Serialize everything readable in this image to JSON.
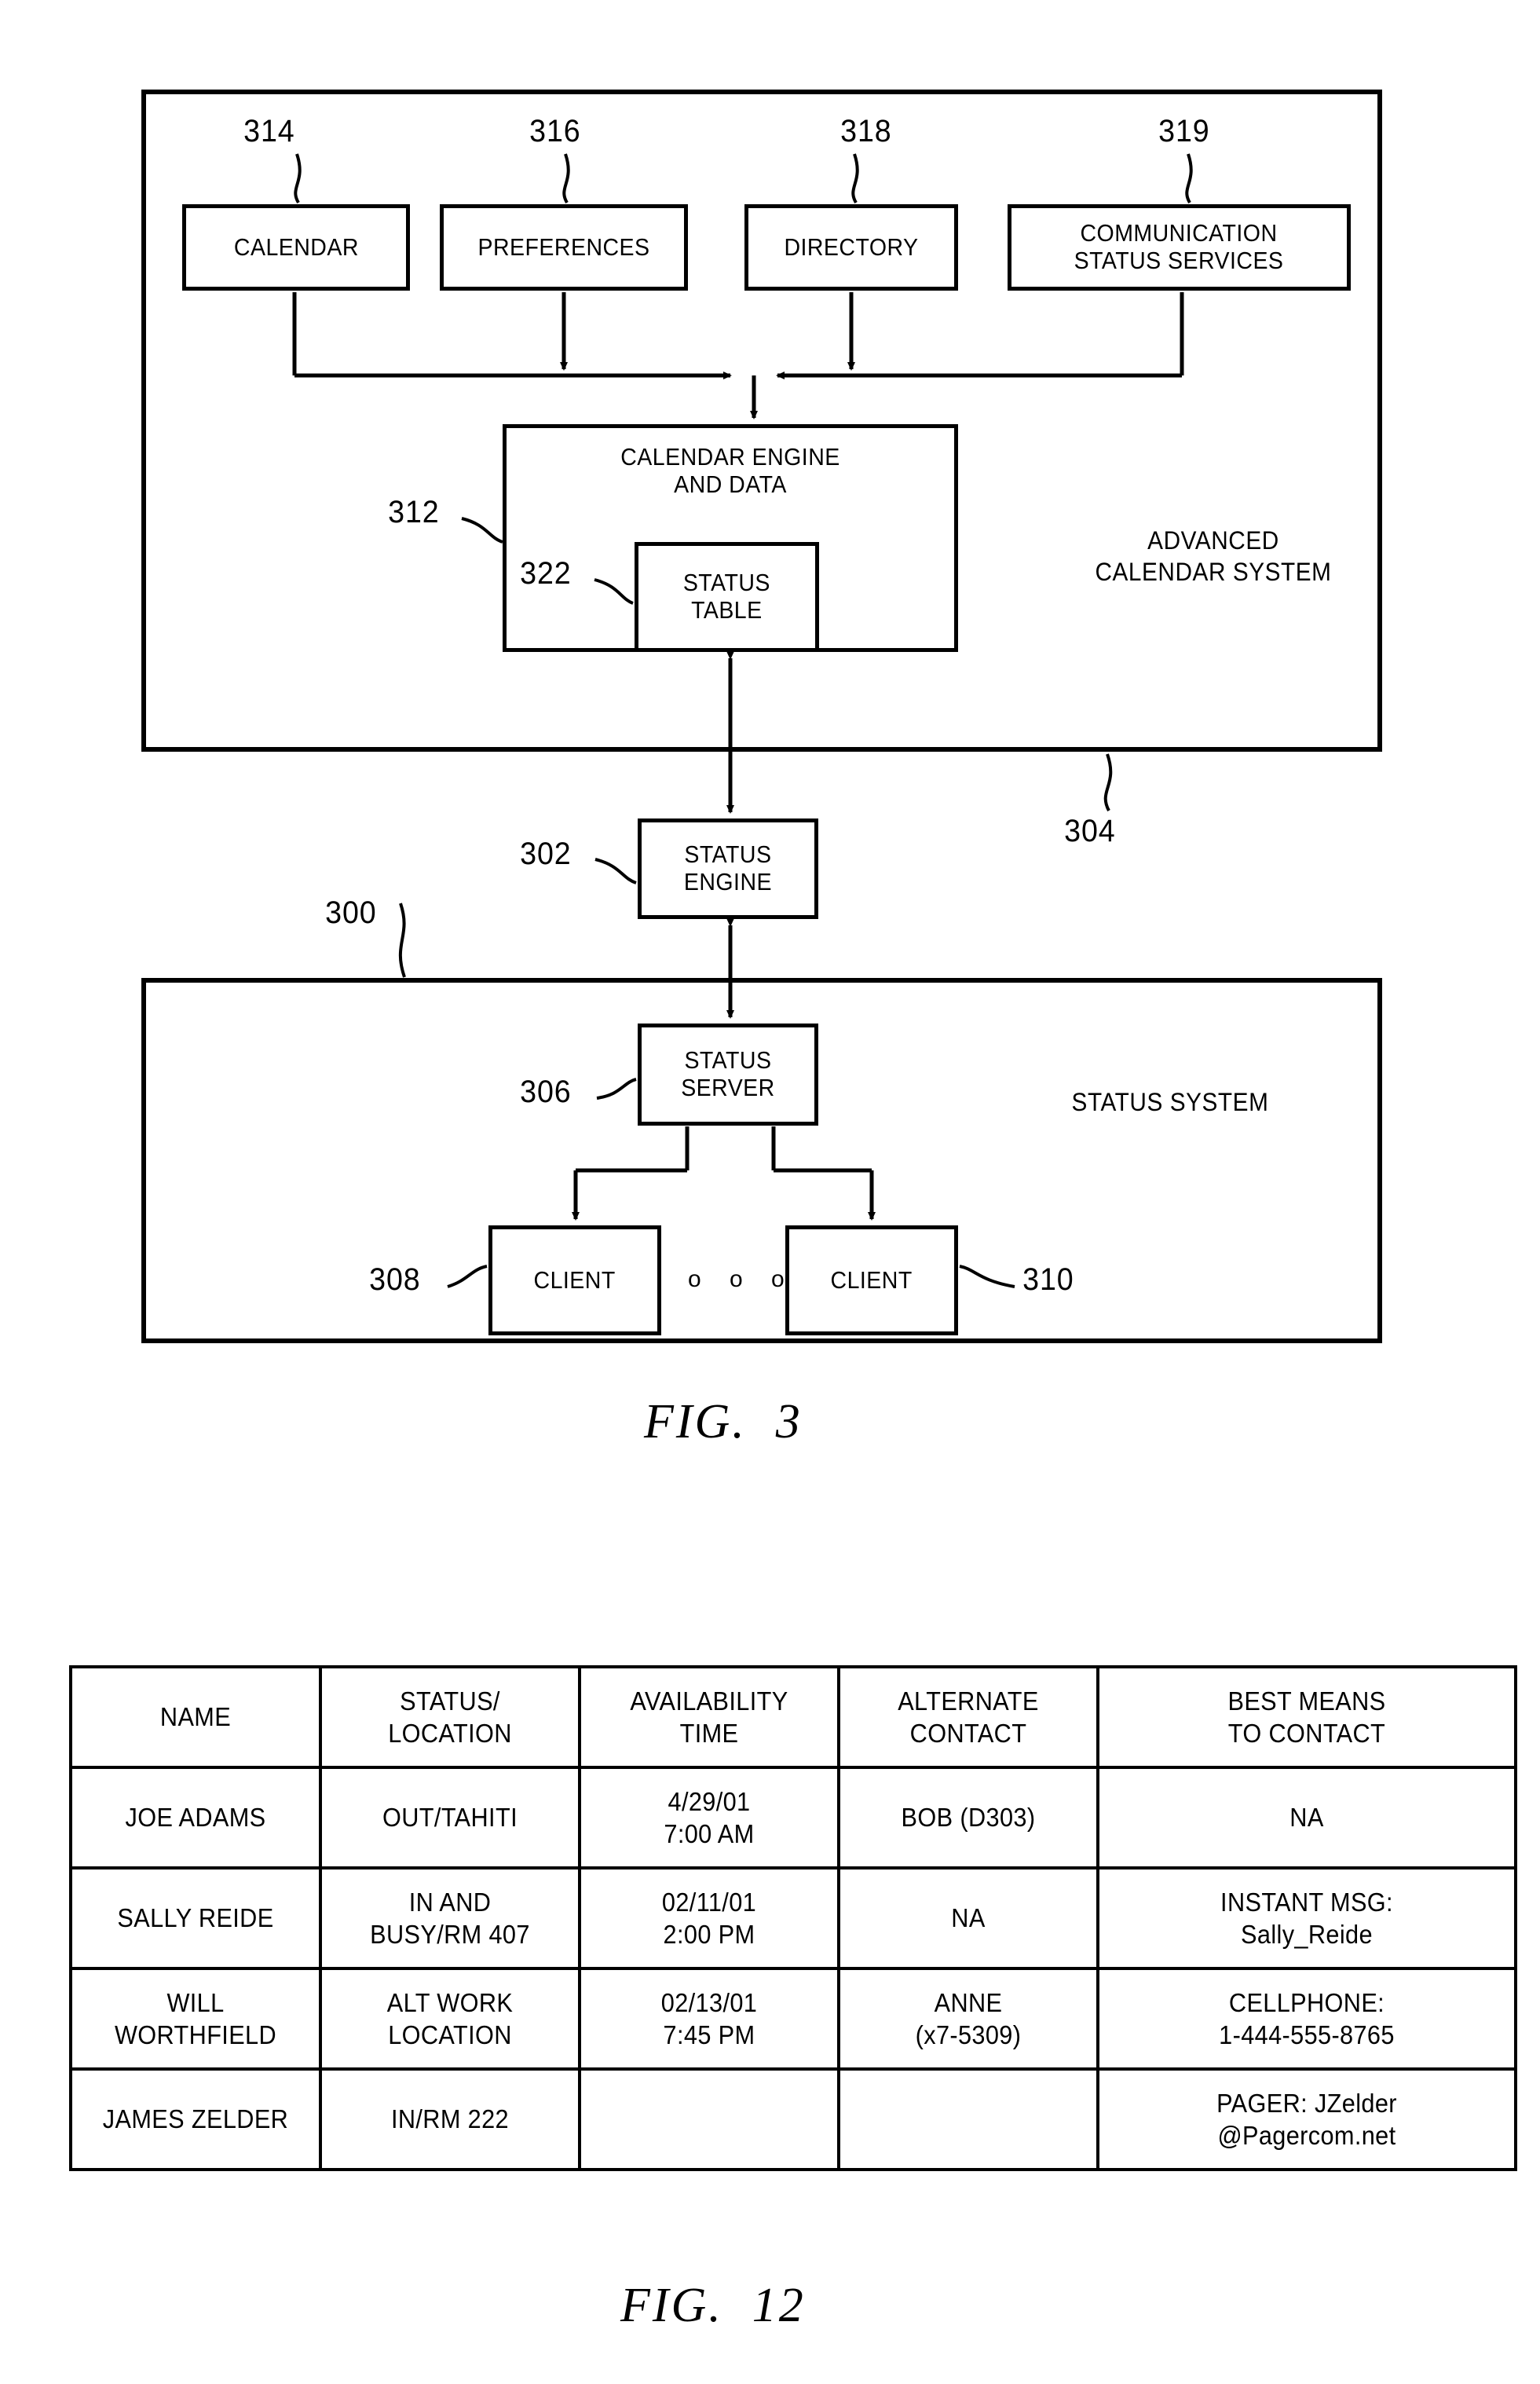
{
  "fig3": {
    "caption": "FIG.  3",
    "advanced_system": {
      "ref": "304",
      "label": "ADVANCED\nCALENDAR SYSTEM",
      "services": [
        {
          "ref": "314",
          "label": "CALENDAR"
        },
        {
          "ref": "316",
          "label": "PREFERENCES"
        },
        {
          "ref": "318",
          "label": "DIRECTORY"
        },
        {
          "ref": "319",
          "label": "COMMUNICATION\nSTATUS SERVICES"
        }
      ],
      "engine": {
        "ref": "312",
        "label": "CALENDAR ENGINE\nAND DATA",
        "status_table": {
          "ref": "322",
          "label": "STATUS\nTABLE"
        }
      }
    },
    "status_engine": {
      "ref": "302",
      "label": "STATUS\nENGINE"
    },
    "status_system": {
      "ref": "300",
      "label": "STATUS SYSTEM",
      "server": {
        "ref": "306",
        "label": "STATUS\nSERVER"
      },
      "clients": [
        {
          "ref": "308",
          "label": "CLIENT"
        },
        {
          "ref": "310",
          "label": "CLIENT"
        }
      ],
      "ellipsis": "o o o"
    }
  },
  "fig12": {
    "caption": "FIG.  12",
    "table": {
      "headers": [
        "NAME",
        "STATUS/\nLOCATION",
        "AVAILABILITY\nTIME",
        "ALTERNATE\nCONTACT",
        "BEST MEANS\nTO CONTACT"
      ],
      "rows": [
        {
          "name": "JOE ADAMS",
          "status_location": "OUT/TAHITI",
          "availability_time": "4/29/01\n7:00 AM",
          "alternate_contact": "BOB (D303)",
          "best_means": "NA"
        },
        {
          "name": "SALLY REIDE",
          "status_location": "IN AND\nBUSY/RM 407",
          "availability_time": "02/11/01\n2:00 PM",
          "alternate_contact": "NA",
          "best_means": "INSTANT MSG:\nSally_Reide"
        },
        {
          "name": "WILL\nWORTHFIELD",
          "status_location": "ALT WORK\nLOCATION",
          "availability_time": "02/13/01\n7:45 PM",
          "alternate_contact": "ANNE\n(x7-5309)",
          "best_means": "CELLPHONE:\n1-444-555-8765"
        },
        {
          "name": "JAMES ZELDER",
          "status_location": "IN/RM 222",
          "availability_time": "",
          "alternate_contact": "",
          "best_means": "PAGER: JZelder\n@Pagercom.net"
        }
      ]
    }
  },
  "colors": {
    "ink": "#000000",
    "paper": "#ffffff"
  }
}
